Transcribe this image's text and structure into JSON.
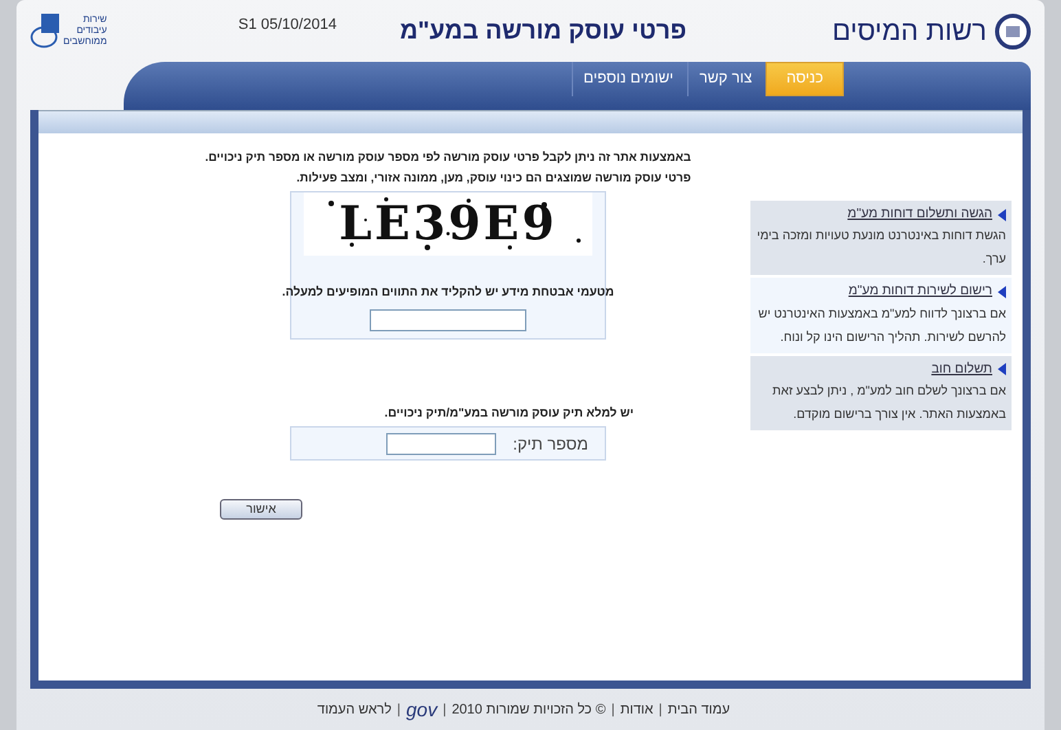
{
  "header": {
    "site_name": "רשות המיסים",
    "page_title": "פרטי עוסק מורשה במע\"מ",
    "date": "S1 05/10/2014",
    "partner_logo_lines": [
      "שירות",
      "עיבודים",
      "ממוחשבים"
    ]
  },
  "tabs": [
    {
      "label": "כניסה",
      "selected": true
    },
    {
      "label": "צור קשר",
      "selected": false
    },
    {
      "label": "ישומים נוספים",
      "selected": false
    }
  ],
  "intro": [
    "באמצעות אתר זה ניתן לקבל פרטי עוסק מורשה לפי מספר עוסק מורשה או מספר תיק ניכויים.",
    "פרטי עוסק מורשה שמוצגים הם כינוי עוסק, מען, ממונה אזורי, ומצב פעילות."
  ],
  "captcha": {
    "text": "LE39E9",
    "instruction": "מטעמי אבטחת מידע יש להקליד את התווים המופיעים למעלה."
  },
  "file_number": {
    "heading": "יש למלא תיק עוסק מורשה במע\"מ/תיק ניכויים.",
    "label": "מספר תיק:"
  },
  "submit": "אישור",
  "sidebar": [
    {
      "title": "הגשה ותשלום דוחות מע\"מ",
      "text": "הגשת דוחות באינטרנט מונעת טעויות ומזכה בימי ערך."
    },
    {
      "title": "רישום לשירות דוחות מע\"מ",
      "text": "אם ברצונך לדווח למע\"מ באמצעות האינטרנט יש להרשם לשירות. תהליך הרישום הינו קל ונוח."
    },
    {
      "title": "תשלום חוב",
      "text": "אם ברצונך לשלם חוב למע\"מ , ניתן לבצע זאת באמצעות האתר. אין צורך ברישום מוקדם."
    }
  ],
  "footer_separator": "|",
  "footer": [
    {
      "kind": "link",
      "text": "עמוד הבית"
    },
    {
      "kind": "link",
      "text": "אודות"
    },
    {
      "kind": "text",
      "text": "© כל הזכויות שמורות 2010"
    },
    {
      "kind": "logo",
      "text": "gov"
    },
    {
      "kind": "link",
      "text": "לראש העמוד"
    }
  ]
}
